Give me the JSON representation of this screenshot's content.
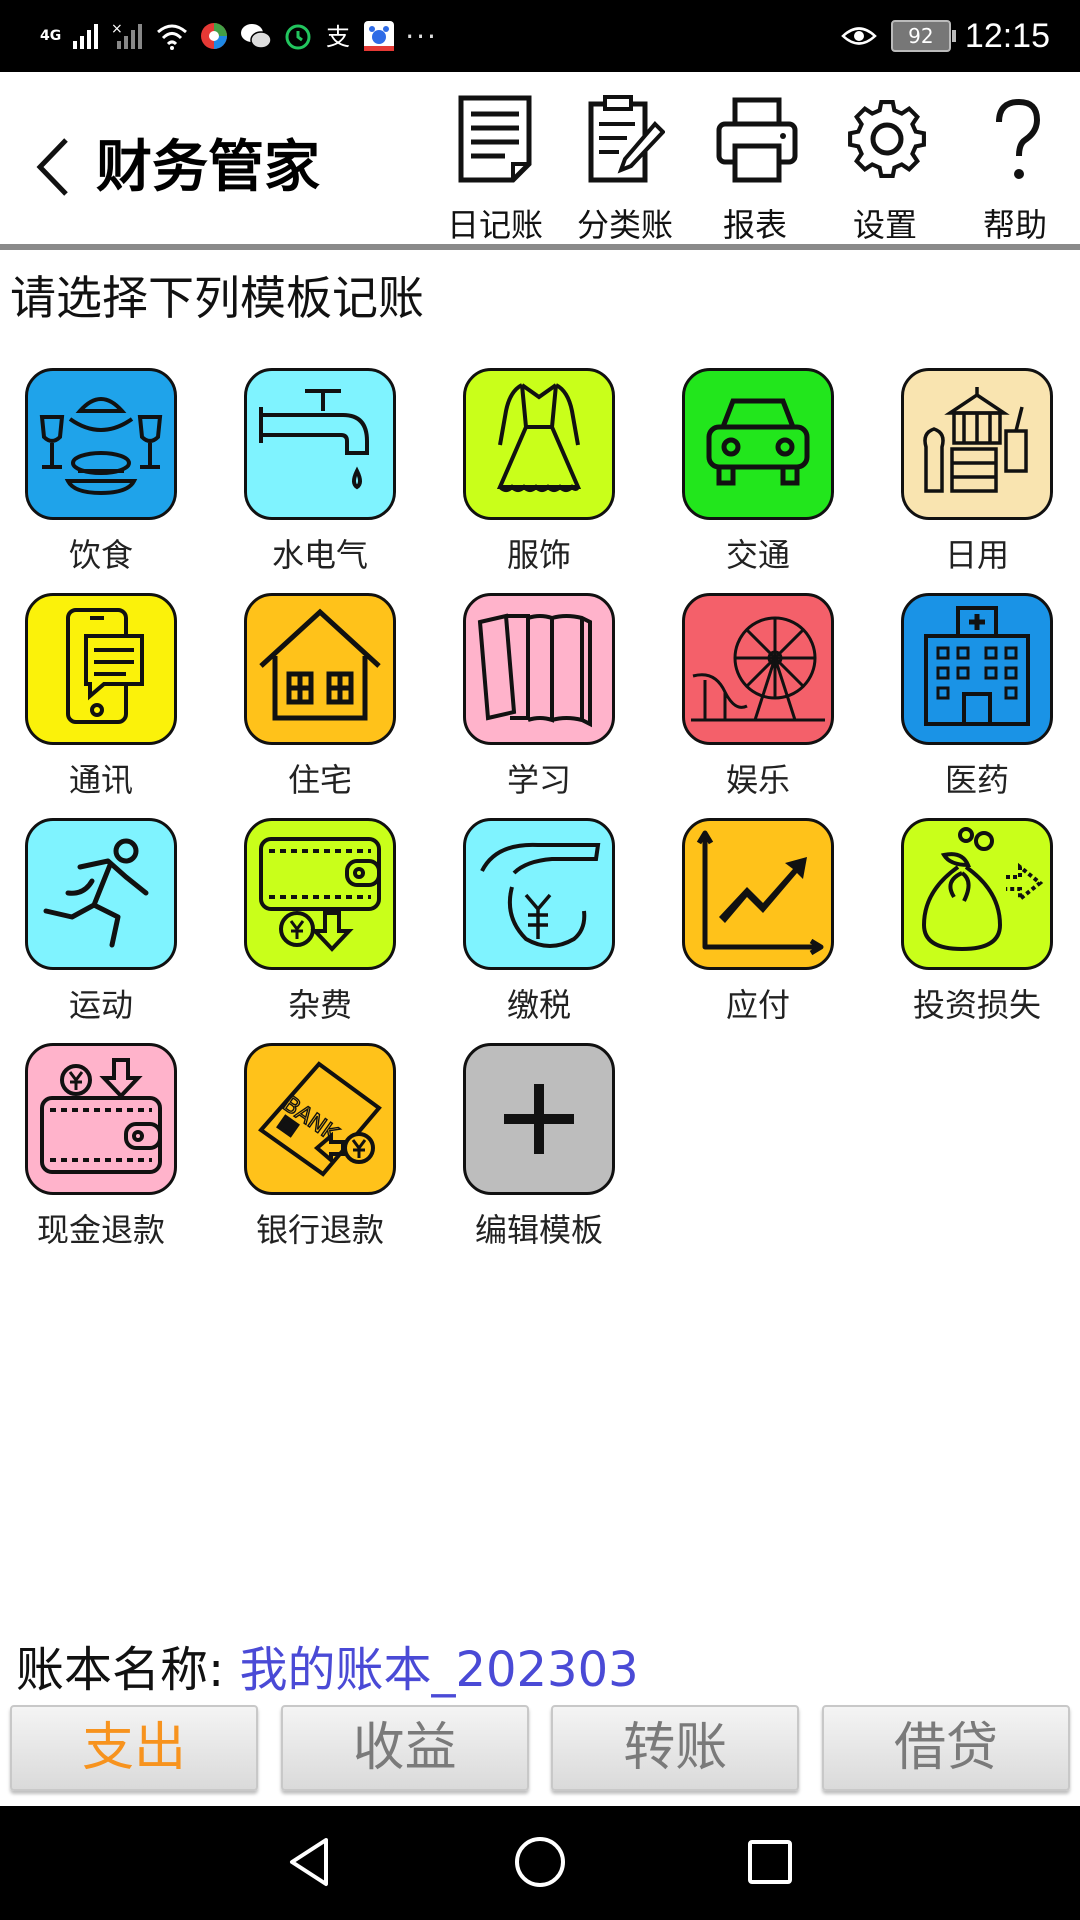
{
  "status_bar": {
    "network": "4G",
    "battery": "92",
    "time": "12:15",
    "more": "···",
    "icons": [
      "signal-icon",
      "no-signal-icon",
      "wifi-icon",
      "app-icon",
      "wechat-icon",
      "alarm-icon",
      "alipay-icon",
      "baidu-icon",
      "eye-icon",
      "battery-icon"
    ]
  },
  "header": {
    "title": "财务管家",
    "tools": [
      {
        "label": "日记账",
        "icon": "journal-icon"
      },
      {
        "label": "分类账",
        "icon": "ledger-edit-icon"
      },
      {
        "label": "报表",
        "icon": "printer-icon"
      },
      {
        "label": "设置",
        "icon": "gear-icon"
      },
      {
        "label": "帮助",
        "icon": "question-icon"
      }
    ]
  },
  "section_title": "请选择下列模板记账",
  "templates": [
    {
      "label": "饮食",
      "icon": "food-icon",
      "color": "#1fa3ea"
    },
    {
      "label": "水电气",
      "icon": "faucet-icon",
      "color": "#7ff3ff"
    },
    {
      "label": "服饰",
      "icon": "dress-icon",
      "color": "#c9ff1a"
    },
    {
      "label": "交通",
      "icon": "car-icon",
      "color": "#22e61c"
    },
    {
      "label": "日用",
      "icon": "daily-goods-icon",
      "color": "#f9e4b0"
    },
    {
      "label": "通讯",
      "icon": "phone-icon",
      "color": "#fbf20a"
    },
    {
      "label": "住宅",
      "icon": "house-icon",
      "color": "#ffc21a"
    },
    {
      "label": "学习",
      "icon": "books-icon",
      "color": "#ffb3cb"
    },
    {
      "label": "娱乐",
      "icon": "ferris-wheel-icon",
      "color": "#f4606a"
    },
    {
      "label": "医药",
      "icon": "hospital-icon",
      "color": "#1a93e6"
    },
    {
      "label": "运动",
      "icon": "runner-icon",
      "color": "#7ff3ff"
    },
    {
      "label": "杂费",
      "icon": "wallet-icon",
      "color": "#c9ff1a"
    },
    {
      "label": "缴税",
      "icon": "tax-hand-icon",
      "color": "#7ff3ff"
    },
    {
      "label": "应付",
      "icon": "growth-chart-icon",
      "color": "#ffc21a"
    },
    {
      "label": "投资损失",
      "icon": "money-bag-icon",
      "color": "#c9ff1a"
    },
    {
      "label": "现金退款",
      "icon": "cash-refund-icon",
      "color": "#ffb3cb"
    },
    {
      "label": "银行退款",
      "icon": "bank-card-refund-icon",
      "color": "#ffc21a"
    },
    {
      "label": "编辑模板",
      "icon": "plus-icon",
      "color": "#bdbdbd"
    }
  ],
  "account": {
    "label": "账本名称: ",
    "value": "我的账本_202303"
  },
  "tabs": [
    {
      "label": "支出",
      "active": true
    },
    {
      "label": "收益",
      "active": false
    },
    {
      "label": "转账",
      "active": false
    },
    {
      "label": "借贷",
      "active": false
    }
  ],
  "colors": {
    "active_tab": "#f7931e",
    "inactive_tab": "#7a7a7a",
    "account_value": "#4a4ad6"
  }
}
